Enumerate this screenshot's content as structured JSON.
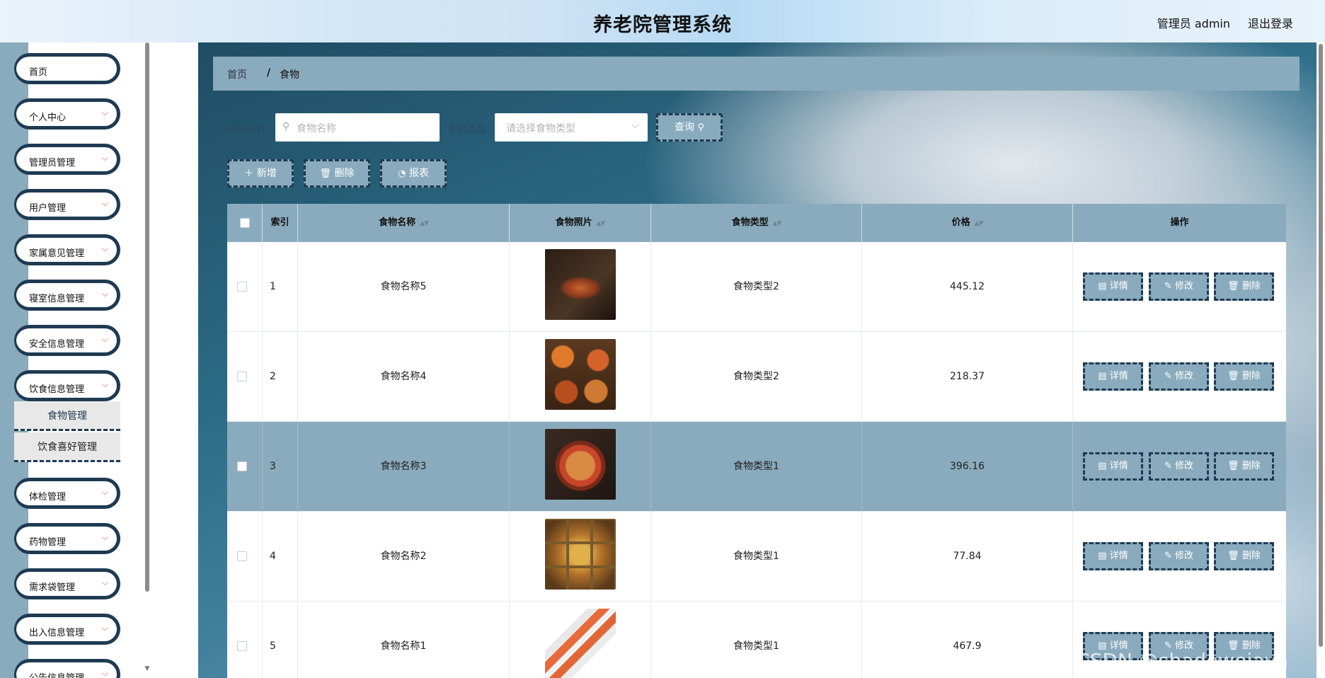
{
  "header": {
    "title": "养老院管理系统",
    "user": "管理员 admin",
    "logout": "退出登录"
  },
  "sidebar": {
    "items": [
      {
        "label": "首页"
      },
      {
        "label": "个人中心"
      },
      {
        "label": "管理员管理"
      },
      {
        "label": "用户管理"
      },
      {
        "label": "家属意见管理"
      },
      {
        "label": "寝室信息管理"
      },
      {
        "label": "安全信息管理"
      },
      {
        "label": "饮食信息管理"
      },
      {
        "label": "体检管理"
      },
      {
        "label": "药物管理"
      },
      {
        "label": "需求袋管理"
      },
      {
        "label": "出入信息管理"
      },
      {
        "label": "公告信息管理"
      }
    ],
    "sub_items": [
      {
        "label": "食物管理"
      },
      {
        "label": "饮食喜好管理"
      }
    ]
  },
  "breadcrumb": {
    "home": "首页",
    "separator": "/",
    "current": "食物"
  },
  "search": {
    "name_label": "食物名称",
    "name_placeholder": "食物名称",
    "type_label": "食物类型",
    "type_placeholder": "请选择食物类型",
    "query_button": "查询"
  },
  "toolbar": {
    "add": "新增",
    "delete": "删除",
    "report": "报表"
  },
  "table": {
    "headers": {
      "index": "索引",
      "name": "食物名称",
      "photo": "食物照片",
      "type": "食物类型",
      "price": "价格",
      "actions": "操作"
    },
    "rows": [
      {
        "index": "1",
        "name": "食物名称5",
        "type": "食物类型2",
        "price": "445.12",
        "highlighted": false
      },
      {
        "index": "2",
        "name": "食物名称4",
        "type": "食物类型2",
        "price": "218.37",
        "highlighted": false
      },
      {
        "index": "3",
        "name": "食物名称3",
        "type": "食物类型1",
        "price": "396.16",
        "highlighted": true
      },
      {
        "index": "4",
        "name": "食物名称2",
        "type": "食物类型1",
        "price": "77.84",
        "highlighted": false
      },
      {
        "index": "5",
        "name": "食物名称1",
        "type": "食物类型1",
        "price": "467.9",
        "highlighted": false
      }
    ],
    "action_labels": {
      "detail": "详情",
      "edit": "修改",
      "delete": "删除"
    }
  },
  "watermark": "CSDN @shadowejava",
  "colors": {
    "accent": "#8aabbd",
    "dark": "#1f3a52",
    "chevron": "#e05252"
  }
}
